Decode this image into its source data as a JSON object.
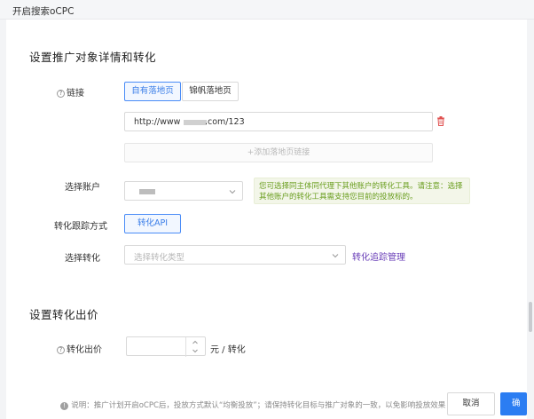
{
  "window": {
    "title": "开启搜索oCPC"
  },
  "section1": {
    "title": "设置推广对象详情和转化",
    "link": {
      "label": "链接",
      "tabs": [
        "自有落地页",
        "锦帆落地页"
      ],
      "url_prefix": "http://www",
      "url_suffix": ".com/123",
      "add_label": "+添加落地页链接"
    },
    "account": {
      "label": "选择账户",
      "tip": "您可选择同主体同代理下其他账户的转化工具。请注意：选择其他账户的转化工具需支持您目前的投放标的。"
    },
    "tracking": {
      "label": "转化跟踪方式",
      "option": "转化API"
    },
    "conversion": {
      "label": "选择转化",
      "placeholder": "选择转化类型",
      "manage_link": "转化追踪管理"
    }
  },
  "section2": {
    "title": "设置转化出价",
    "bid": {
      "label": "转化出价",
      "value": "",
      "unit": "元 / 转化"
    }
  },
  "footer": {
    "note": "说明：推广计划开启oCPC后，投放方式默认“均衡投放”；请保持转化目标与推广对象的一致，以免影响投放效果",
    "cancel": "取消",
    "confirm": "确定"
  },
  "icons": {
    "delete": "trash-icon",
    "help": "question-icon",
    "info": "info-icon",
    "dropdown": "chevron-down-icon"
  },
  "colors": {
    "primary": "#2b7df2",
    "tip_text": "#6a9e1f",
    "link": "#6a3fb8",
    "delete": "#e0504f"
  }
}
